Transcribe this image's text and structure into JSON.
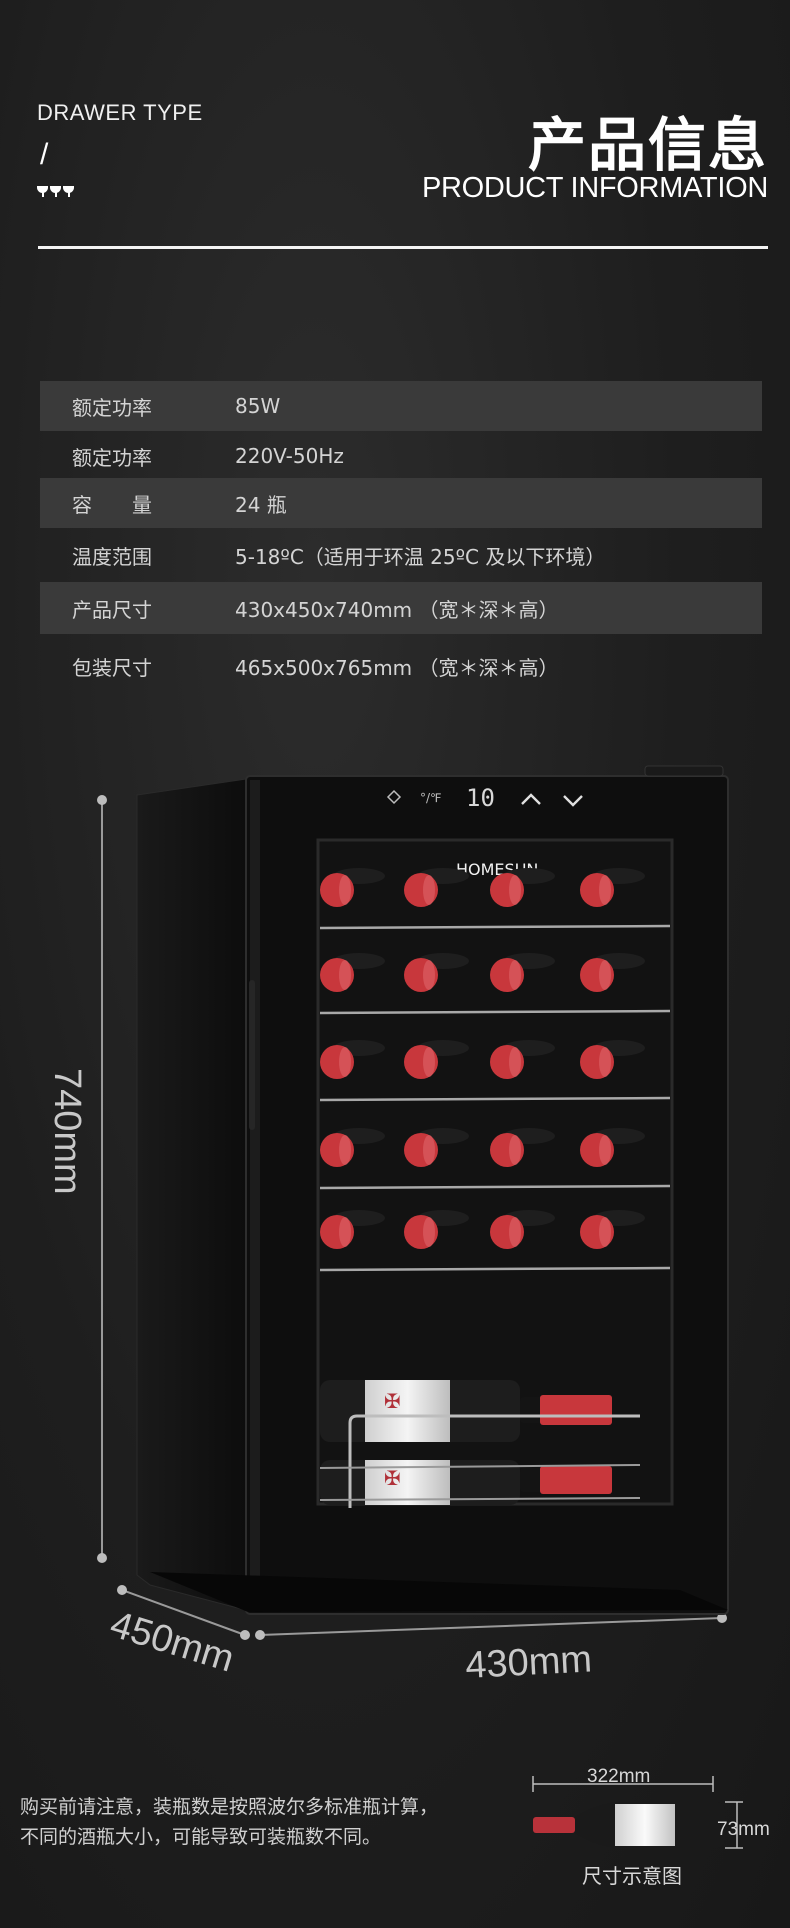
{
  "header": {
    "drawer_type": "DRAWER TYPE",
    "slash": "/",
    "title_cn": "产品信息",
    "title_en": "PRODUCT INFORMATION",
    "icon": "wine-glasses-icon"
  },
  "specs": [
    {
      "label": "额定功率",
      "value": "85W"
    },
    {
      "label": "额定功率",
      "value": "220V-50Hz"
    },
    {
      "label": "容　　量",
      "value": "24 瓶"
    },
    {
      "label": "温度范围",
      "value": "5-18ºC（适用于环温 25ºC 及以下环境）"
    },
    {
      "label": "产品尺寸",
      "value": " 430x450x740mm （宽＊深＊高）"
    },
    {
      "label": "包装尺寸",
      "value": "465x500x765mm （宽＊深＊高）"
    }
  ],
  "fridge": {
    "brand": "HOMESUN",
    "display": "10",
    "height_label": "740mm",
    "depth_label": "450mm",
    "width_label": "430mm",
    "shelf_bottles": [
      4,
      4,
      4,
      4,
      4
    ],
    "bottle_color": "#c8373c"
  },
  "note": {
    "line1": "购买前请注意，装瓶数是按照波尔多标准瓶计算，",
    "line2": "不同的酒瓶大小，可能导致可装瓶数不同。"
  },
  "bottle_legend": {
    "length": "322mm",
    "diameter": "73mm",
    "caption": "尺寸示意图"
  }
}
